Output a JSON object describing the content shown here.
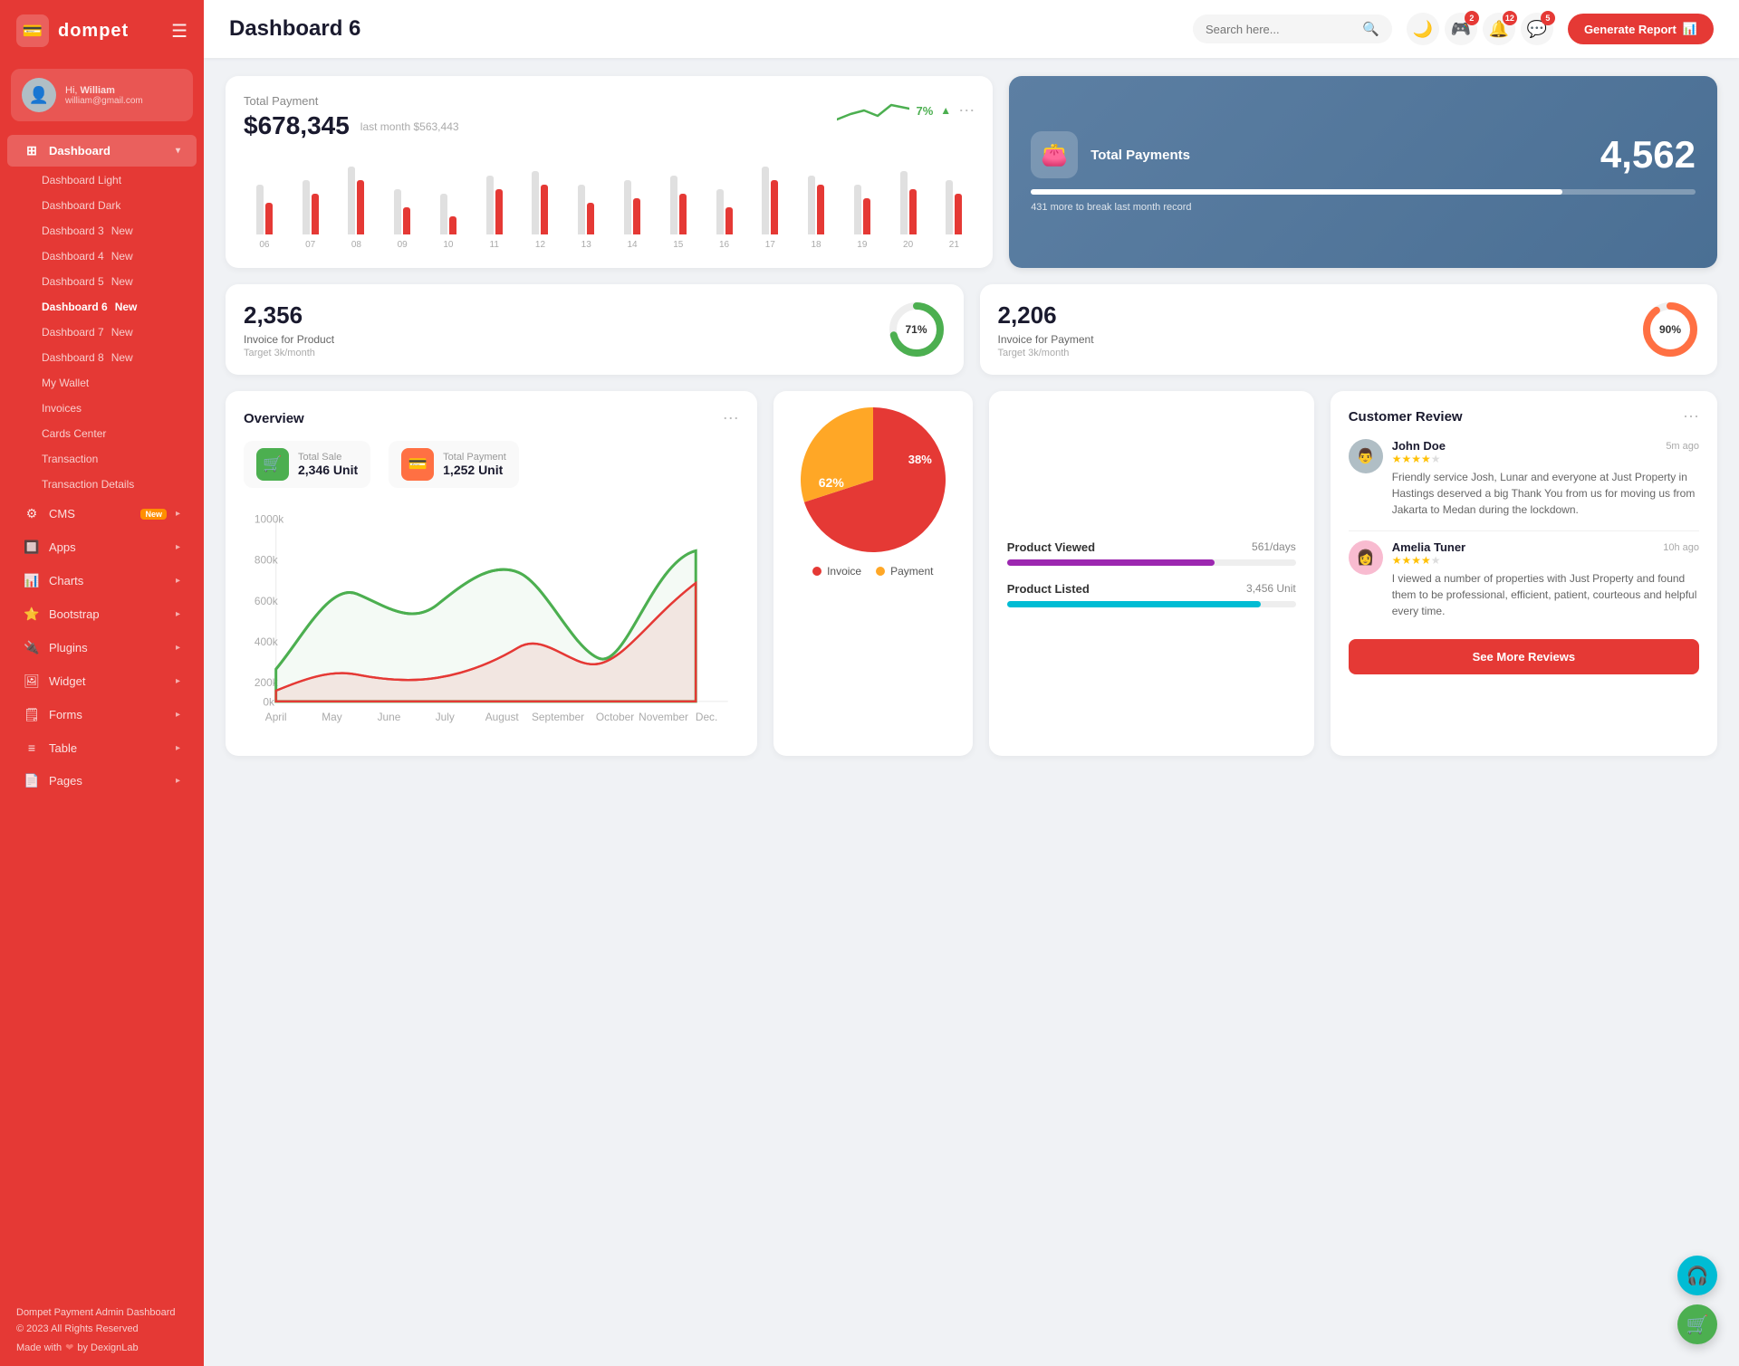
{
  "app": {
    "name": "dompet",
    "logo_icon": "💳"
  },
  "user": {
    "greeting": "Hi,",
    "name": "William",
    "email": "william@gmail.com",
    "avatar": "👤"
  },
  "header": {
    "page_title": "Dashboard 6",
    "search_placeholder": "Search here...",
    "generate_report_label": "Generate Report",
    "badges": {
      "gamepad": "2",
      "bell": "12",
      "chat": "5"
    }
  },
  "sidebar": {
    "nav_items": [
      {
        "id": "dashboard",
        "label": "Dashboard",
        "icon": "⊞",
        "expandable": true,
        "active": true
      },
      {
        "id": "cms",
        "label": "CMS",
        "icon": "⚙",
        "expandable": true,
        "badge": "New"
      },
      {
        "id": "apps",
        "label": "Apps",
        "icon": "🔲",
        "expandable": true
      },
      {
        "id": "charts",
        "label": "Charts",
        "icon": "📊",
        "expandable": true
      },
      {
        "id": "bootstrap",
        "label": "Bootstrap",
        "icon": "⭐",
        "expandable": true
      },
      {
        "id": "plugins",
        "label": "Plugins",
        "icon": "🔌",
        "expandable": true
      },
      {
        "id": "widget",
        "label": "Widget",
        "icon": "🖼",
        "expandable": true
      },
      {
        "id": "forms",
        "label": "Forms",
        "icon": "🗒",
        "expandable": true
      },
      {
        "id": "table",
        "label": "Table",
        "icon": "≡",
        "expandable": true
      },
      {
        "id": "pages",
        "label": "Pages",
        "icon": "📄",
        "expandable": true
      }
    ],
    "sub_items": [
      {
        "label": "Dashboard Light",
        "active": false
      },
      {
        "label": "Dashboard Dark",
        "active": false
      },
      {
        "label": "Dashboard 3",
        "badge": "New",
        "active": false
      },
      {
        "label": "Dashboard 4",
        "badge": "New",
        "active": false
      },
      {
        "label": "Dashboard 5",
        "badge": "New",
        "active": false
      },
      {
        "label": "Dashboard 6",
        "badge": "New",
        "active": true
      },
      {
        "label": "Dashboard 7",
        "badge": "New",
        "active": false
      },
      {
        "label": "Dashboard 8",
        "badge": "New",
        "active": false
      },
      {
        "label": "My Wallet",
        "active": false
      },
      {
        "label": "Invoices",
        "active": false
      },
      {
        "label": "Cards Center",
        "active": false
      },
      {
        "label": "Transaction",
        "active": false
      },
      {
        "label": "Transaction Details",
        "active": false
      }
    ],
    "footer": {
      "brand": "Dompet Payment Admin Dashboard",
      "copyright": "© 2023 All Rights Reserved",
      "made_with": "Made with",
      "made_by": "by DexignLab"
    }
  },
  "total_payment_card": {
    "title": "Total Payment",
    "amount": "$678,345",
    "last_month_label": "last month $563,443",
    "trend_pct": "7%",
    "bars": [
      {
        "label": "06",
        "gray": 55,
        "red": 35
      },
      {
        "label": "07",
        "gray": 60,
        "red": 45
      },
      {
        "label": "08",
        "gray": 75,
        "red": 60
      },
      {
        "label": "09",
        "gray": 50,
        "red": 30
      },
      {
        "label": "10",
        "gray": 45,
        "red": 20
      },
      {
        "label": "11",
        "gray": 65,
        "red": 50
      },
      {
        "label": "12",
        "gray": 70,
        "red": 55
      },
      {
        "label": "13",
        "gray": 55,
        "red": 35
      },
      {
        "label": "14",
        "gray": 60,
        "red": 40
      },
      {
        "label": "15",
        "gray": 65,
        "red": 45
      },
      {
        "label": "16",
        "gray": 50,
        "red": 30
      },
      {
        "label": "17",
        "gray": 75,
        "red": 60
      },
      {
        "label": "18",
        "gray": 65,
        "red": 55
      },
      {
        "label": "19",
        "gray": 55,
        "red": 40
      },
      {
        "label": "20",
        "gray": 70,
        "red": 50
      },
      {
        "label": "21",
        "gray": 60,
        "red": 45
      }
    ]
  },
  "total_payments_blue": {
    "title": "Total Payments",
    "value": "4,562",
    "sub": "431 more to break last month record",
    "bar_pct": 80,
    "icon": "👛"
  },
  "invoice_product": {
    "value": "2,356",
    "label": "Invoice for Product",
    "target": "Target 3k/month",
    "pct": 71,
    "color": "#4caf50"
  },
  "invoice_payment": {
    "value": "2,206",
    "label": "Invoice for Payment",
    "target": "Target 3k/month",
    "pct": 90,
    "color": "#ff7043"
  },
  "overview": {
    "title": "Overview",
    "total_sale": {
      "label": "Total Sale",
      "value": "2,346 Unit"
    },
    "total_payment": {
      "label": "Total Payment",
      "value": "1,252 Unit"
    },
    "x_labels": [
      "April",
      "May",
      "June",
      "July",
      "August",
      "September",
      "October",
      "November",
      "Dec."
    ]
  },
  "pie_chart": {
    "invoice_pct": 62,
    "payment_pct": 38,
    "invoice_label": "Invoice",
    "payment_label": "Payment",
    "invoice_color": "#e53935",
    "payment_color": "#ffa726"
  },
  "product_stats": {
    "viewed": {
      "label": "Product Viewed",
      "count": "561/days",
      "pct": 72
    },
    "listed": {
      "label": "Product Listed",
      "count": "3,456 Unit",
      "pct": 88
    }
  },
  "customer_review": {
    "title": "Customer Review",
    "see_more_label": "See More Reviews",
    "reviews": [
      {
        "name": "John Doe",
        "time": "5m ago",
        "stars": 4,
        "text": "Friendly service Josh, Lunar and everyone at Just Property in Hastings deserved a big Thank You from us for moving us from Jakarta to Medan during the lockdown.",
        "avatar": "👨"
      },
      {
        "name": "Amelia Tuner",
        "time": "10h ago",
        "stars": 4,
        "text": "I viewed a number of properties with Just Property and found them to be professional, efficient, patient, courteous and helpful every time.",
        "avatar": "👩"
      }
    ]
  },
  "floating": {
    "support_icon": "🎧",
    "cart_icon": "🛒"
  }
}
